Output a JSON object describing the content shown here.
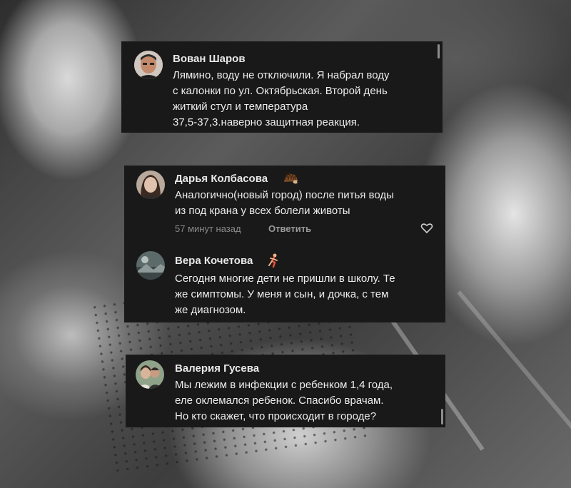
{
  "comments": [
    {
      "author": "Вован Шаров",
      "lines": [
        "Лямино, воду не отключили. Я набрал воду",
        "с калонки по ул. Октябрьская. Второй день",
        "житкий стул и температура",
        "37,5-37,3.наверно защитная реакция."
      ],
      "avatar_icon": "person-avatar-icon"
    },
    {
      "author": "Дарья Колбасова",
      "emoji_icon": "hedgehog-emoji-icon",
      "lines": [
        "Аналогично(новый город) после питья воды",
        "из под крана у всех болели животы"
      ],
      "time": "57 минут назад",
      "reply_label": "Ответить",
      "avatar_icon": "person-avatar-icon"
    },
    {
      "author": "Вера Кочетова",
      "emoji_icon": "runner-emoji-icon",
      "lines": [
        "Сегодня многие дети не пришли в школу. Те",
        "же симптомы. У меня и сын, и дочка, с тем",
        "же диагнозом."
      ],
      "avatar_icon": "photo-avatar-icon"
    },
    {
      "author": "Валерия Гусева",
      "lines": [
        "Мы лежим в инфекции с ребенком 1,4 года,",
        "еле  оклемался ребенок. Спасибо врачам.",
        "Но кто скажет, что  происходит в городе?"
      ],
      "avatar_icon": "couple-avatar-icon"
    }
  ],
  "colors": {
    "card_bg": "#191919",
    "text": "#ededed",
    "muted": "#8a8a8a"
  }
}
